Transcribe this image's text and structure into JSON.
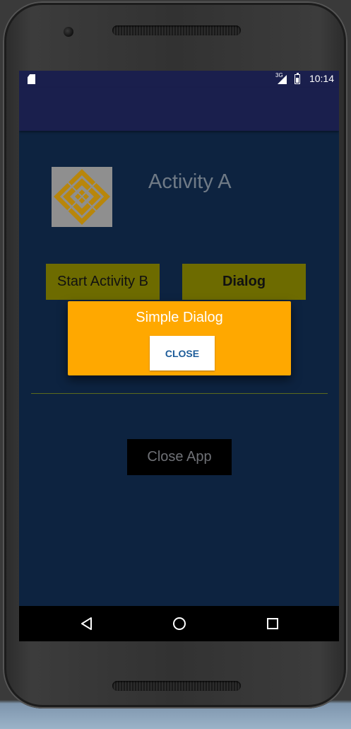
{
  "status_bar": {
    "time": "10:14",
    "network": "3G",
    "icons": [
      "sd-card-icon",
      "signal-icon",
      "battery-icon"
    ]
  },
  "main": {
    "title": "Activity A",
    "logo": "ornamental-logo-icon",
    "start_b_label": "Start Activity B",
    "dialog_button_label": "Dialog",
    "close_app_label": "Close App"
  },
  "dialog": {
    "title": "Simple Dialog",
    "close_label": "CLOSE"
  },
  "nav_bar": {
    "icons": [
      "back-icon",
      "home-icon",
      "recents-icon"
    ]
  },
  "colors": {
    "screen_background": "#0d2340",
    "app_bar": "#1a1f4d",
    "button_olive": "#6d6b00",
    "dialog_background": "#ffa800",
    "dialog_button_text": "#1d5c99",
    "close_app_background": "#000000"
  }
}
